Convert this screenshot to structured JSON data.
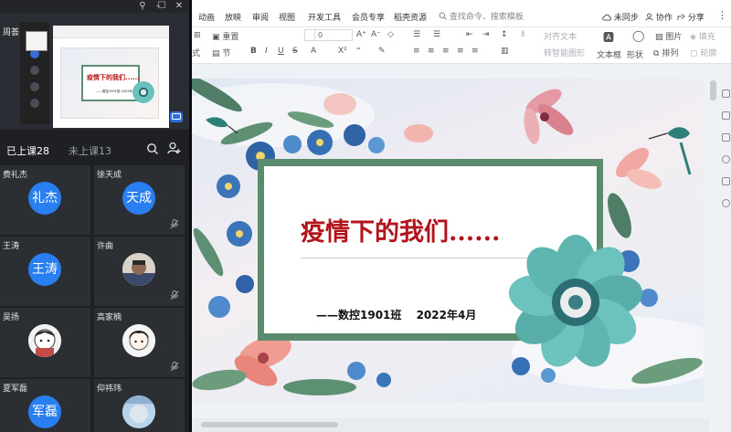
{
  "classroom": {
    "teacher_name": "周荟",
    "window_controls": {
      "pin": "⚲",
      "minimize": "–",
      "maximize": "☐",
      "close": "✕"
    },
    "tabs": {
      "joined": "已上课28",
      "absent": "未上课13"
    },
    "preview": {
      "title": "疫情下的我们......",
      "subtitle": "——数控1901班 2022年4月"
    },
    "students": [
      {
        "name": "费礼杰",
        "avatar_text": "礼杰",
        "muted": false
      },
      {
        "name": "徐天成",
        "avatar_text": "天成",
        "muted": true
      },
      {
        "name": "王涛",
        "avatar_text": "王涛",
        "muted": false
      },
      {
        "name": "许曲",
        "avatar_text": "",
        "muted": true
      },
      {
        "name": "吴扬",
        "avatar_text": "",
        "muted": false
      },
      {
        "name": "高家楠",
        "avatar_text": "",
        "muted": true
      },
      {
        "name": "夏军磊",
        "avatar_text": "军磊",
        "muted": false
      },
      {
        "name": "仰祎玮",
        "avatar_text": "",
        "muted": false
      }
    ]
  },
  "wps": {
    "menu": [
      "动画",
      "放映",
      "审阅",
      "视图",
      "开发工具",
      "会员专享",
      "稻壳资源"
    ],
    "search_placeholder": "查找命令、搜索模板",
    "right_menu": {
      "sync": "未同步",
      "collab": "协作",
      "share": "分享"
    },
    "toolbar": {
      "reset": "重置",
      "section_left": "式",
      "section": "节",
      "font_size": "0",
      "align_text": "对齐文本",
      "convert_smartart": "转智能图形",
      "textbox": "文本框",
      "shape": "形状",
      "arrange": "排列",
      "image": "图片",
      "fill": "填充",
      "outline": "轮廓"
    },
    "slide": {
      "title": "疫情下的我们......",
      "subtitle": "——数控1901班 2022年4月"
    }
  },
  "colors": {
    "title_red": "#b3141c",
    "card_green": "#5b8b6d",
    "avatar_blue": "#2a7ff0",
    "panel_dark": "#1e2023",
    "tile": "#2b2e33"
  }
}
